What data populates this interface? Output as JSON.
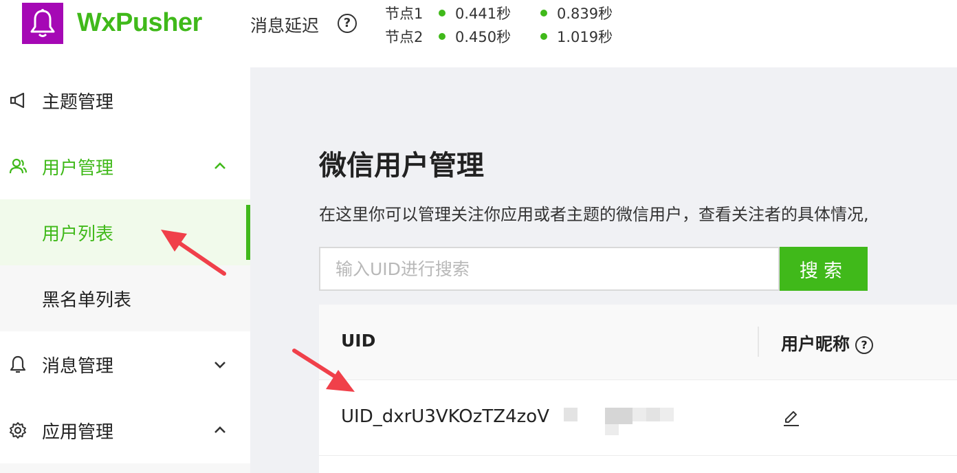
{
  "header": {
    "brand": "WxPusher",
    "latency_label": "消息延迟",
    "help_glyph": "?",
    "nodes": [
      {
        "name": "节点1",
        "val1": "0.441秒",
        "val2": "0.839秒"
      },
      {
        "name": "节点2",
        "val1": "0.450秒",
        "val2": "1.019秒"
      }
    ],
    "status_color": "#40b91a"
  },
  "sidebar": {
    "items": [
      {
        "label": "主题管理",
        "icon": "megaphone-icon"
      },
      {
        "label": "用户管理",
        "icon": "user-icon",
        "chevron": "up"
      },
      {
        "label": "消息管理",
        "icon": "bell-icon",
        "chevron": "down"
      },
      {
        "label": "应用管理",
        "icon": "gear-icon",
        "chevron": "up"
      }
    ],
    "subitems": [
      {
        "label": "用户列表"
      },
      {
        "label": "黑名单列表"
      }
    ]
  },
  "main": {
    "title": "微信用户管理",
    "description": "在这里你可以管理关注你应用或者主题的微信用户，查看关注者的具体情况,",
    "search": {
      "placeholder": "输入UID进行搜索",
      "button": "搜索"
    },
    "table": {
      "columns": [
        "UID",
        "用户昵称"
      ],
      "rows": [
        {
          "uid": "UID_dxrU3VKOzTZ4zoV"
        }
      ]
    }
  },
  "accent_color": "#40b91a",
  "logo_color": "#a508b5"
}
